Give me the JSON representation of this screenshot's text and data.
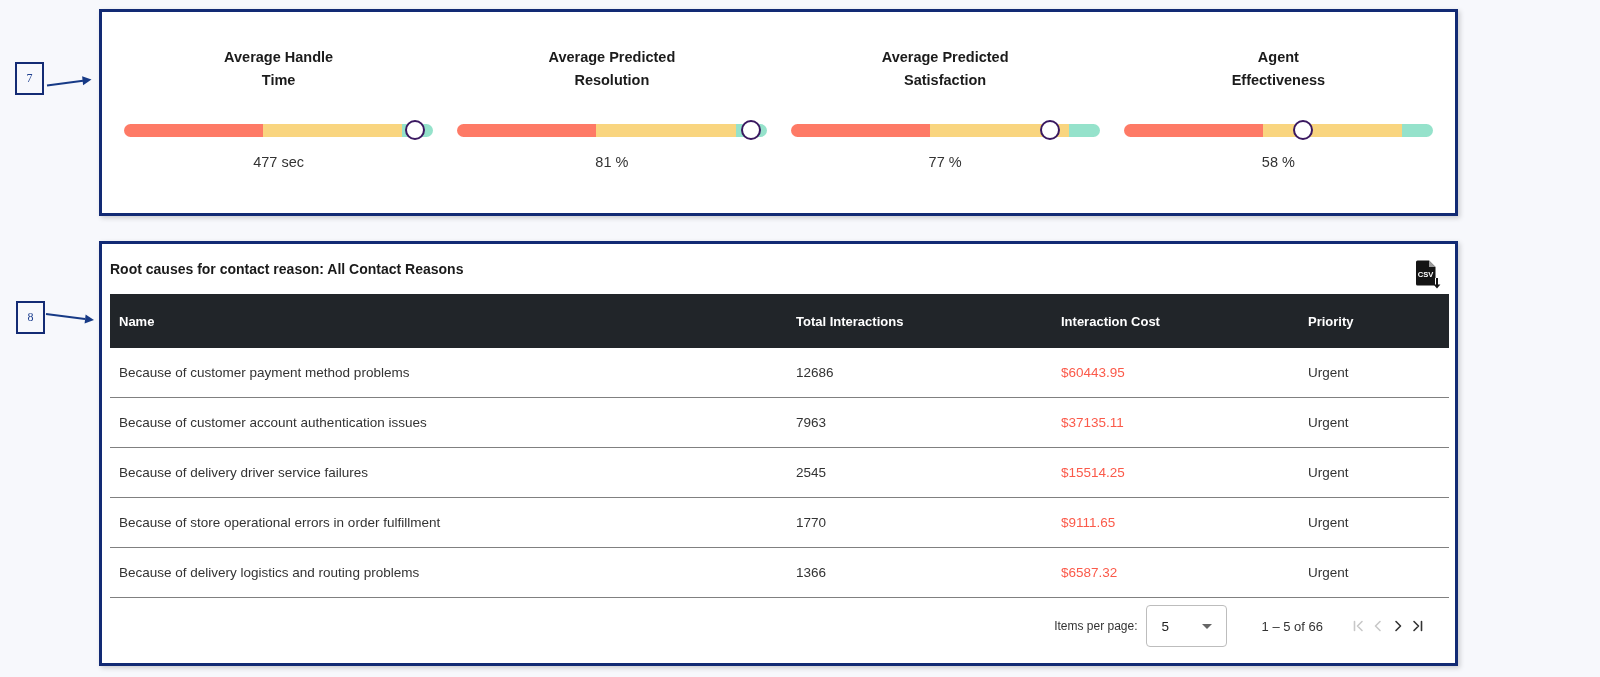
{
  "metrics_panel": {
    "callout": "7",
    "metrics": [
      {
        "title": "Average Handle Time",
        "level": 0.94,
        "value": "477 sec"
      },
      {
        "title": "Average Predicted Resolution",
        "level": 0.95,
        "value": "81 %"
      },
      {
        "title": "Average Predicted Satisfaction",
        "level": 0.84,
        "value": "77 %"
      },
      {
        "title": "Agent Effectiveness",
        "level": 0.58,
        "value": "58 %"
      }
    ]
  },
  "root_causes_panel": {
    "callout": "8",
    "title": "Root causes for contact reason: All Contact Reasons",
    "export_label": "CSV",
    "columns": [
      "Name",
      "Total Interactions",
      "Interaction Cost",
      "Priority"
    ],
    "rows": [
      {
        "name": "Because of customer payment method problems",
        "total_interactions": "12686",
        "interaction_cost": "$60443.95",
        "priority": "Urgent"
      },
      {
        "name": "Because of customer account authentication issues",
        "total_interactions": "7963",
        "interaction_cost": "$37135.11",
        "priority": "Urgent"
      },
      {
        "name": "Because of delivery driver service failures",
        "total_interactions": "2545",
        "interaction_cost": "$15514.25",
        "priority": "Urgent"
      },
      {
        "name": "Because of store operational errors in order fulfillment",
        "total_interactions": "1770",
        "interaction_cost": "$9111.65",
        "priority": "Urgent"
      },
      {
        "name": "Because of delivery logistics and routing problems",
        "total_interactions": "1366",
        "interaction_cost": "$6587.32",
        "priority": "Urgent"
      }
    ],
    "paginator": {
      "label": "Items per page:",
      "page_size": "5",
      "range": "1 – 5 of 66",
      "buttons": [
        {
          "kind": "first",
          "disabled": true
        },
        {
          "kind": "previous",
          "disabled": true
        },
        {
          "kind": "next",
          "disabled": false
        },
        {
          "kind": "last",
          "disabled": false
        }
      ]
    }
  }
}
